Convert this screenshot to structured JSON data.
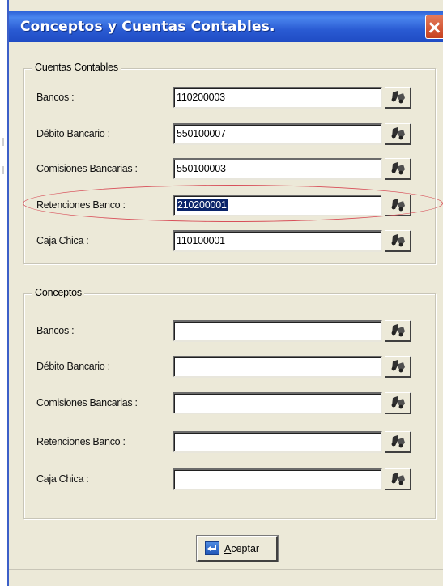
{
  "window": {
    "title": "Conceptos  y Cuentas Contables."
  },
  "accounts_group": {
    "title": "Cuentas Contables",
    "rows": [
      {
        "label": "Bancos :",
        "value": "110200003"
      },
      {
        "label": "Débito Bancario :",
        "value": "550100007"
      },
      {
        "label": "Comisiones Bancarias :",
        "value": "550100003"
      },
      {
        "label": "Retenciones Banco :",
        "value": "210200001"
      },
      {
        "label": "Caja Chica :",
        "value": "110100001"
      }
    ]
  },
  "concepts_group": {
    "title": "Conceptos",
    "rows": [
      {
        "label": "Bancos :",
        "value": ""
      },
      {
        "label": "Débito Bancario :",
        "value": ""
      },
      {
        "label": "Comisiones Bancarias :",
        "value": ""
      },
      {
        "label": "Retenciones Banco :",
        "value": ""
      },
      {
        "label": "Caja Chica :",
        "value": ""
      }
    ]
  },
  "ok_button": {
    "label_underlined": "A",
    "label_rest": "ceptar"
  },
  "icons": {
    "close": "close-icon",
    "lookup": "binoculars-icon",
    "ok": "enter-arrow-icon"
  },
  "colors": {
    "titlebar": "#2a5bd3",
    "selection": "#0a246a",
    "highlight_ellipse": "#d8505a"
  }
}
